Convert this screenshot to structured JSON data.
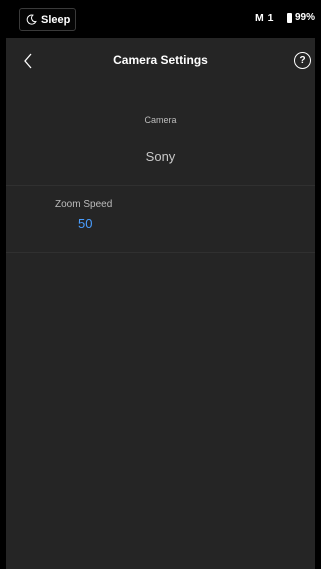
{
  "status_bar": {
    "sleep_label": "Sleep",
    "mode_label": "M 1",
    "battery_label": "99%"
  },
  "header": {
    "title": "Camera Settings",
    "help_label": "?"
  },
  "camera": {
    "label": "Camera",
    "value": "Sony"
  },
  "zoom_speed": {
    "label": "Zoom Speed",
    "value": "50"
  },
  "colors": {
    "background": "#000000",
    "panel": "#252525",
    "accent": "#4a9eff"
  },
  "icons": {
    "sleep": "moon-icon",
    "battery": "battery-icon",
    "back": "chevron-left-icon",
    "help": "help-icon"
  }
}
